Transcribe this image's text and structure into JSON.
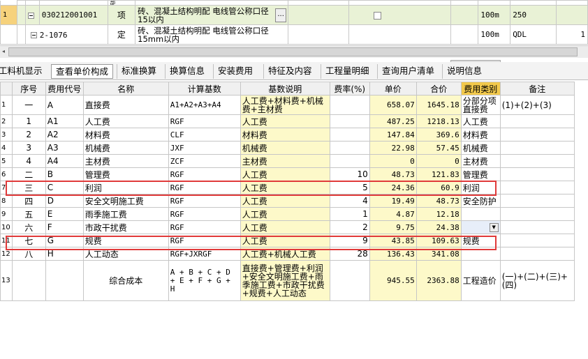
{
  "top_rows": [
    {
      "row_no": "1",
      "code": "030212001001",
      "unit_type": "项",
      "name": "砖、混凝土结构明配 电线管公称口径15以内",
      "unit": "100m",
      "qty": "250",
      "extra": ""
    },
    {
      "row_no": "",
      "code": "2-1076",
      "unit_type": "定",
      "name": "砖、混凝土结构明配 电线管公称口径15mm以内",
      "unit": "100m",
      "qty": "QDL",
      "extra": "1"
    }
  ],
  "top_partial_text": "部",
  "tabs": [
    "工料机显示",
    "查看单价构成",
    "标准换算",
    "换算信息",
    "安装费用",
    "特征及内容",
    "工程量明细",
    "查询用户清单",
    "说明信息"
  ],
  "active_tab": "查看单价构成",
  "columns": [
    "序号",
    "费用代号",
    "名称",
    "计算基数",
    "基数说明",
    "费率(%)",
    "单价",
    "合价",
    "费用类别",
    "备注"
  ],
  "rows": [
    {
      "rn": "1",
      "seq": "一",
      "code": "A",
      "name": "直接费",
      "base": "A1+A2+A3+A4",
      "desc": "人工费+材料费+机械费+主材费",
      "rate": "",
      "price": "658.07",
      "total": "1645.18",
      "cat": "分部分项直接费",
      "note": "(1)+(2)+(3)"
    },
    {
      "rn": "2",
      "seq": "1",
      "code": "A1",
      "name": "人工费",
      "base": "RGF",
      "desc": "人工费",
      "rate": "",
      "price": "487.25",
      "total": "1218.13",
      "cat": "人工费",
      "note": ""
    },
    {
      "rn": "3",
      "seq": "2",
      "code": "A2",
      "name": "材料费",
      "base": "CLF",
      "desc": "材料费",
      "rate": "",
      "price": "147.84",
      "total": "369.6",
      "cat": "材料费",
      "note": ""
    },
    {
      "rn": "4",
      "seq": "3",
      "code": "A3",
      "name": "机械费",
      "base": "JXF",
      "desc": "机械费",
      "rate": "",
      "price": "22.98",
      "total": "57.45",
      "cat": "机械费",
      "note": ""
    },
    {
      "rn": "5",
      "seq": "4",
      "code": "A4",
      "name": "主材费",
      "base": "ZCF",
      "desc": "主材费",
      "rate": "",
      "price": "0",
      "total": "0",
      "cat": "主材费",
      "note": ""
    },
    {
      "rn": "6",
      "seq": "二",
      "code": "B",
      "name": "管理费",
      "base": "RGF",
      "desc": "人工费",
      "rate": "10",
      "price": "48.73",
      "total": "121.83",
      "cat": "管理费",
      "note": ""
    },
    {
      "rn": "7",
      "seq": "三",
      "code": "C",
      "name": "利润",
      "base": "RGF",
      "desc": "人工费",
      "rate": "5",
      "price": "24.36",
      "total": "60.9",
      "cat": "利润",
      "note": ""
    },
    {
      "rn": "8",
      "seq": "四",
      "code": "D",
      "name": "安全文明施工费",
      "base": "RGF",
      "desc": "人工费",
      "rate": "4",
      "price": "19.49",
      "total": "48.73",
      "cat": "安全防护",
      "note": ""
    },
    {
      "rn": "9",
      "seq": "五",
      "code": "E",
      "name": "雨季施工费",
      "base": "RGF",
      "desc": "人工费",
      "rate": "1",
      "price": "4.87",
      "total": "12.18",
      "cat": "",
      "note": ""
    },
    {
      "rn": "10",
      "seq": "六",
      "code": "F",
      "name": "市政干扰费",
      "base": "RGF",
      "desc": "人工费",
      "rate": "2",
      "price": "9.75",
      "total": "24.38",
      "cat": "",
      "note": ""
    },
    {
      "rn": "11",
      "seq": "七",
      "code": "G",
      "name": "规费",
      "base": "RGF",
      "desc": "人工费",
      "rate": "9",
      "price": "43.85",
      "total": "109.63",
      "cat": "规费",
      "note": ""
    },
    {
      "rn": "12",
      "seq": "八",
      "code": "H",
      "name": "人工动态",
      "base": "RGF+JXRGF",
      "desc": "人工费+机械人工费",
      "rate": "28",
      "price": "136.43",
      "total": "341.08",
      "cat": "",
      "note": ""
    },
    {
      "rn": "13",
      "seq": "",
      "code": "",
      "name": "综合成本",
      "base": "A + B + C + D + E + F + G + H",
      "desc": "直接费+管理费+利润+安全文明施工费+雨季施工费+市政干扰费+规费+人工动态",
      "rate": "",
      "price": "945.55",
      "total": "2363.88",
      "cat": "工程造价",
      "note": "(一)+(二)+(三)+(四)"
    }
  ],
  "colors": {
    "highlight_border": "#e03a3a",
    "yellow_cell": "#fdf9c9",
    "header_active": "#f2c94c",
    "top_row_bg": "#e9f2d6"
  }
}
